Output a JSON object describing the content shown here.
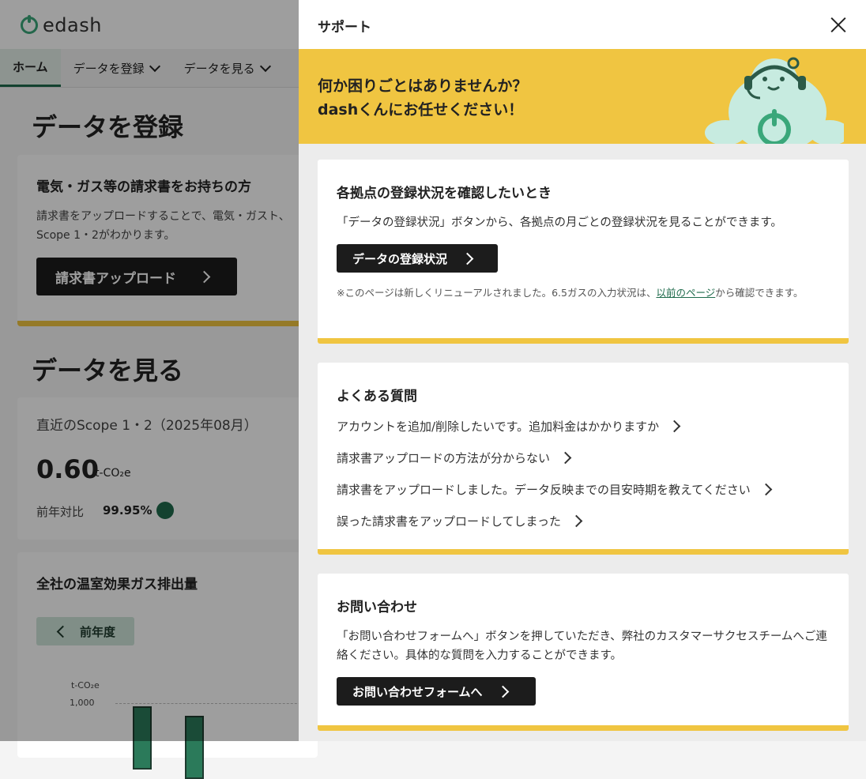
{
  "app": {
    "logo_text": "edash",
    "nav": [
      "ホーム",
      "データを登録",
      "データを見る"
    ],
    "register": {
      "title": "データを登録",
      "card_title": "電気・ガス等の請求書をお持ちの方",
      "card_text": "請求書をアップロードすることで、電気・ガスト、Scope 1・2がわかります。",
      "button": "請求書アップロード"
    },
    "view": {
      "title": "データを見る",
      "recent_label": "直近のScope 1・2（2025年08月）",
      "value": "0.60",
      "unit": "t-CO₂e",
      "yoy_label": "前年対比",
      "yoy_value": "99.95%",
      "chart_card_title": "全社の温室効果ガス排出量",
      "prev_year_button": "前年度",
      "chart_unit": "t-CO₂e",
      "chart_tick": "1,000"
    }
  },
  "chart_data": {
    "type": "bar",
    "ylabel": "t-CO₂e",
    "yticks": [
      "1,000"
    ],
    "values": [
      960,
      840
    ]
  },
  "panel": {
    "title": "サポート",
    "banner_line1": "何か困りごとはありませんか？",
    "banner_line2": "dashくんにお任せください！",
    "status": {
      "title": "各拠点の登録状況を確認したいとき",
      "text": "「データの登録状況」ボタンから、各拠点の月ごとの登録状況を見ることができます。",
      "button": "データの登録状況",
      "note_before": "※このページは新しくリニューアルされました。6.5ガスの入力状況は、",
      "note_link": "以前のページ",
      "note_after": "から確認できます。"
    },
    "faq": {
      "title": "よくある質問",
      "items": [
        "アカウントを追加/削除したいです。追加料金はかかりますか",
        "請求書アップロードの方法が分からない",
        "請求書をアップロードしました。データ反映までの目安時期を教えてください",
        "誤った請求書をアップロードしてしまった"
      ]
    },
    "contact": {
      "title": "お問い合わせ",
      "text": "「お問い合わせフォームへ」ボタンを押していただき、弊社のカスタマーサクセスチームへご連絡ください。具体的な質問を入力することができます。",
      "button": "お問い合わせフォームへ"
    }
  },
  "colors": {
    "accent": "#f0c541",
    "brand": "#1f6b4c",
    "button": "#1c1c1c"
  }
}
